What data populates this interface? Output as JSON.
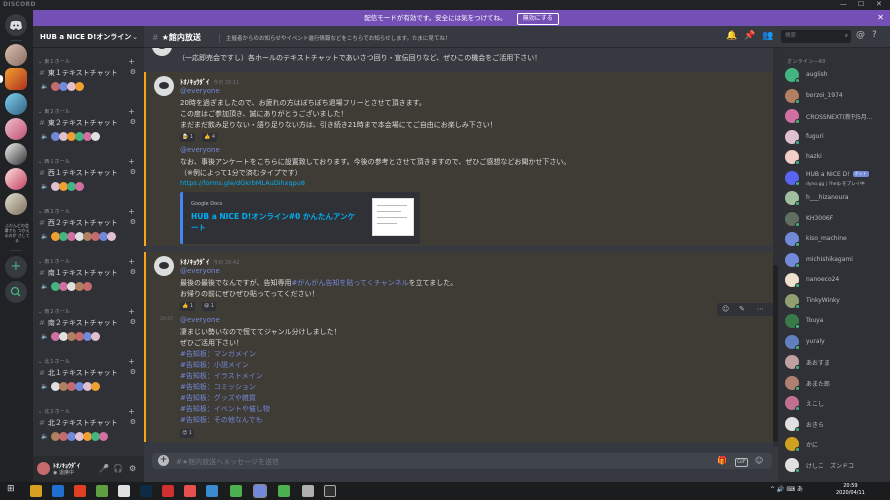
{
  "window": {
    "brand": "DISCORD",
    "minimize": "—",
    "maximize": "☐",
    "close": "✕"
  },
  "banner": {
    "text": "配信モードが有効です。安全には気をつけてね。",
    "button": "無効にする",
    "close": "✕"
  },
  "guild_sidebar": {
    "home_icon": "discord-logo-icon",
    "add_icon": "+",
    "explore_icon": "compass-icon",
    "server_text": "ふだんどの会場でも\nつかえるのが\nさしてる"
  },
  "server": {
    "name": "HUB a NICE D!オンライン",
    "chevron": "⌄"
  },
  "categories": [
    {
      "label": "東１ホール",
      "channel": "東１テキストチャット"
    },
    {
      "label": "東２ホール",
      "channel": "東２テキストチャット"
    },
    {
      "label": "西１ホール",
      "channel": "西１テキストチャット"
    },
    {
      "label": "西２ホール",
      "channel": "西２テキストチャット"
    },
    {
      "label": "南１ホール",
      "channel": "南１テキストチャット"
    },
    {
      "label": "南２ホール",
      "channel": "南２テキストチャット"
    },
    {
      "label": "北１ホール",
      "channel": "北１テキストチャット"
    },
    {
      "label": "北２ホール",
      "channel": "北２テキストチャット"
    }
  ],
  "user_panel": {
    "name": "ﾄｵﾉｷｮｳﾀﾞｲ",
    "status": "◉ 退席中",
    "mic": "🎤",
    "headset": "🎧",
    "settings": "⚙"
  },
  "channel_header": {
    "name": "★館内放送",
    "topic": "主催者からのお知らせやイベント進行情報などをこちらでお知らせします。たまに見てね！",
    "search_placeholder": "検索"
  },
  "messages": {
    "top_line": "（一応即売会ですし）各ホールのテキストチャットであいさつ回り・宣伝回りなど、ぜひこの機会をご活用下さい！",
    "m1": {
      "author": "ﾄｵﾉｷｮｳﾀﾞｲ",
      "time": "今日 20:11",
      "lines": [
        "@everyone",
        "20時を過ぎましたので、お疲れの方はぼちぼち退場フリーとさせて頂きます。",
        "この度はご参加頂き、誠にありがとうございました！",
        "まだまだ飲み足りない・語り足りない方は、引き続き21時まで本会場にてご自由にお楽しみ下さい！"
      ],
      "reactions": [
        "🍺 1",
        "👍 4"
      ],
      "lines2": [
        "@everyone",
        "なお、事後アンケートをこちらに設置致しております。今後の参考とさせて頂きますので、ぜひご感想などお聞かせ下さい。",
        "（※例によって1分で済むタイプです）"
      ],
      "link": "https://forms.gle/dGkrbMLAuDihxqpu8",
      "embed": {
        "provider": "Google Docs",
        "title": "HUB a NICE D!オンライン#0 かんたんアンケート"
      }
    },
    "m2": {
      "author": "ﾄｵﾉｷｮｳﾀﾞｲ",
      "time": "今日 20:42",
      "line1": "@everyone",
      "line2_pre": "最後の最後でなんですが、告知専用",
      "line2_ch": "#がんがん告知を貼ってくチャンネル",
      "line2_post": "を立てました。",
      "line3": "お帰りの前にぜひぜひ貼ってってください！",
      "reactions": [
        "👍 1",
        "😃 1"
      ]
    },
    "m3": {
      "time": "20:47",
      "lines": [
        "@everyone",
        "凄まじい勢いなので慌ててジャンル分けしました！",
        "ぜひご活用下さい！"
      ],
      "channels": [
        "#告知板：マンガメイン",
        "#告知板：小説メイン",
        "#告知板：イラストメイン",
        "#告知板：コミッション",
        "#告知板：グッズや雑貨",
        "#告知板：イベントや催し物",
        "#告知板：その他なんでも"
      ],
      "reaction": "😍 1"
    }
  },
  "composer": {
    "placeholder": "#★館内放送へメッセージを送信",
    "gift": "🎁",
    "gif": "GIF",
    "emoji": "☺"
  },
  "members": {
    "header": "オンライン—60",
    "list": [
      {
        "name": "auglish",
        "color": "#43b581"
      },
      {
        "name": "borzoi_1974",
        "color": "#b08060"
      },
      {
        "name": "CROSSNEXT(新刊5月…",
        "color": "#d070a0"
      },
      {
        "name": "fuguri",
        "color": "#e0c0d0"
      },
      {
        "name": "hazki",
        "color": "#f2d0c8"
      },
      {
        "name": "HUB a NICE D!",
        "color": "#5865f2",
        "bot": "ボット",
        "sub": "dyno.gg | ?help をプレイ中"
      },
      {
        "name": "h___hizanoura",
        "color": "#a0c0a0"
      },
      {
        "name": "KH3006F",
        "color": "#607060"
      },
      {
        "name": "kiso_machine",
        "color": "#7289da"
      },
      {
        "name": "michishikagami",
        "color": "#7289da"
      },
      {
        "name": "nanoeco24",
        "color": "#f0e0d0"
      },
      {
        "name": "TinkyWinky",
        "color": "#90a070"
      },
      {
        "name": "Touya",
        "color": "#3a7a4a"
      },
      {
        "name": "yuraly",
        "color": "#6080c0"
      },
      {
        "name": "あおすま",
        "color": "#c0a0a0"
      },
      {
        "name": "あまた郎",
        "color": "#b08070"
      },
      {
        "name": "えこし",
        "color": "#c07090"
      },
      {
        "name": "おきら",
        "color": "#e0e0e0"
      },
      {
        "name": "かに",
        "color": "#d0a020"
      },
      {
        "name": "けしこ　ズンドコ",
        "color": "#e0e0e0"
      }
    ]
  },
  "taskbar": {
    "start": "⊞",
    "tray": "^ 🔊 ⌨ あ",
    "time": "20:59",
    "date": "2020/04/11"
  },
  "colors": {
    "accent": "#7289da",
    "banner": "#7450b6",
    "mention_bar": "#faa61a",
    "online": "#43b581"
  }
}
